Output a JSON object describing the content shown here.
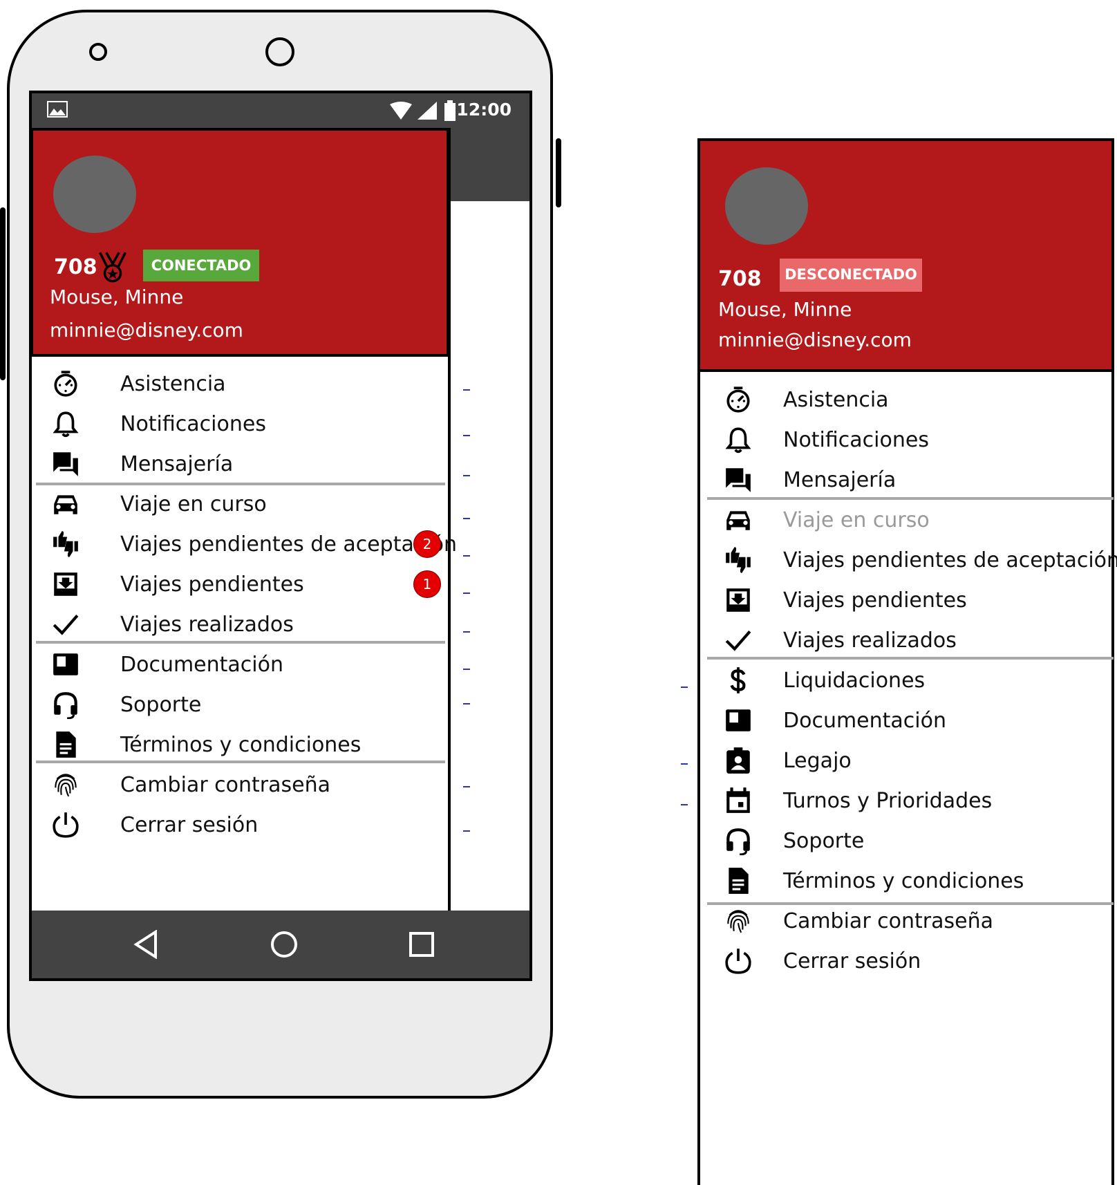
{
  "status_bar": {
    "time": "12:00"
  },
  "connected_drawer": {
    "id": "708",
    "status": "CONECTADO",
    "name": "Mouse, Minne",
    "email": "minnie@disney.com",
    "menu": {
      "asistencia": "Asistencia",
      "notificaciones": "Notificaciones",
      "mensajeria": "Mensajería",
      "viaje_en_curso": "Viaje en curso",
      "pendientes_aceptacion": "Viajes pendientes de aceptación",
      "pendientes_aceptacion_count": "2",
      "pendientes": "Viajes pendientes",
      "pendientes_count": "1",
      "realizados": "Viajes realizados",
      "documentacion": "Documentación",
      "soporte": "Soporte",
      "terminos": "Términos y condiciones",
      "cambiar_contrasena": "Cambiar contraseña",
      "cerrar_sesion": "Cerrar sesión"
    }
  },
  "disconnected_drawer": {
    "id": "708",
    "status": "DESCONECTADO",
    "name": "Mouse, Minne",
    "email": "minnie@disney.com",
    "menu": {
      "asistencia": "Asistencia",
      "notificaciones": "Notificaciones",
      "mensajeria": "Mensajería",
      "viaje_en_curso": "Viaje en curso",
      "pendientes_aceptacion": "Viajes pendientes de aceptación",
      "pendientes": "Viajes pendientes",
      "realizados": "Viajes realizados",
      "liquidaciones": "Liquidaciones",
      "documentacion": "Documentación",
      "legajo": "Legajo",
      "turnos": "Turnos y Prioridades",
      "soporte": "Soporte",
      "terminos": "Términos y condiciones",
      "cambiar_contrasena": "Cambiar contraseña",
      "cerrar_sesion": "Cerrar sesión"
    }
  },
  "colors": {
    "header_red": "#b3191b",
    "connected_green": "#58a83c",
    "disconnected_pink": "#e9696a",
    "bar_dark": "#434343",
    "badge_red": "#e40000",
    "avatar_gray": "#666666"
  },
  "icons": [
    "timer-icon",
    "bell-icon",
    "chat-icon",
    "car-icon",
    "thumbs-icon",
    "inbox-icon",
    "check-icon",
    "dollar-icon",
    "book-icon",
    "badge-icon",
    "calendar-icon",
    "headset-icon",
    "document-icon",
    "fingerprint-icon",
    "power-icon",
    "medal-icon",
    "gallery-icon",
    "wifi-icon",
    "signal-icon",
    "battery-icon",
    "back-icon",
    "home-icon",
    "recents-icon"
  ]
}
